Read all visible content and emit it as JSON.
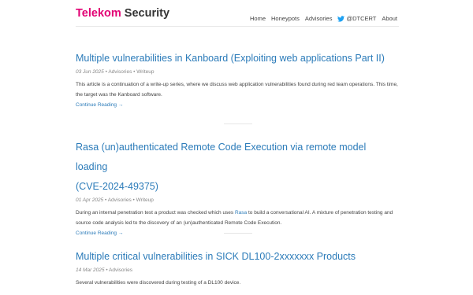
{
  "site": {
    "brand_part1": "Telekom",
    "brand_part2": "Security",
    "accent_color": "#e20074",
    "link_color": "#2b7bb9"
  },
  "nav": {
    "home": "Home",
    "honeypots": "Honeypots",
    "advisories": "Advisories",
    "twitter_icon": "twitter-bird-icon",
    "twitter_handle": "@DTCERT",
    "about": "About"
  },
  "posts": [
    {
      "title": "Multiple vulnerabilities in Kanboard (Exploiting web applications Part II)",
      "date": "03 Jun 2025",
      "tags": "• Advisories • Writeup",
      "excerpt": "This article is a continuation of a write-up series, where we discuss web application vulnerabilities found during red team operations. This time, the target was the Kanboard software.",
      "continue": "Continue Reading →"
    },
    {
      "title_line1": "Rasa (un)authenticated Remote Code Execution via remote model loading",
      "title_line2": "(CVE-2024-49375)",
      "date": "01 Apr 2025",
      "tags": "• Advisories • Writeup",
      "excerpt_before": "During an internal penetration test a product was checked which uses ",
      "excerpt_link": "Rasa",
      "excerpt_after": " to build a conversational AI. A mixture of penetration testing and source code analysis led to the discovery of an (un)authenticated Remote Code Execution.",
      "continue": "Continue Reading →"
    },
    {
      "title": "Multiple critical vulnerabilities in SICK DL100-2xxxxxxx Products",
      "date": "14 Mar 2025",
      "tags": "• Advisories",
      "excerpt": "Several vulnerabilities were discovered during testing of a DL100 device."
    }
  ]
}
